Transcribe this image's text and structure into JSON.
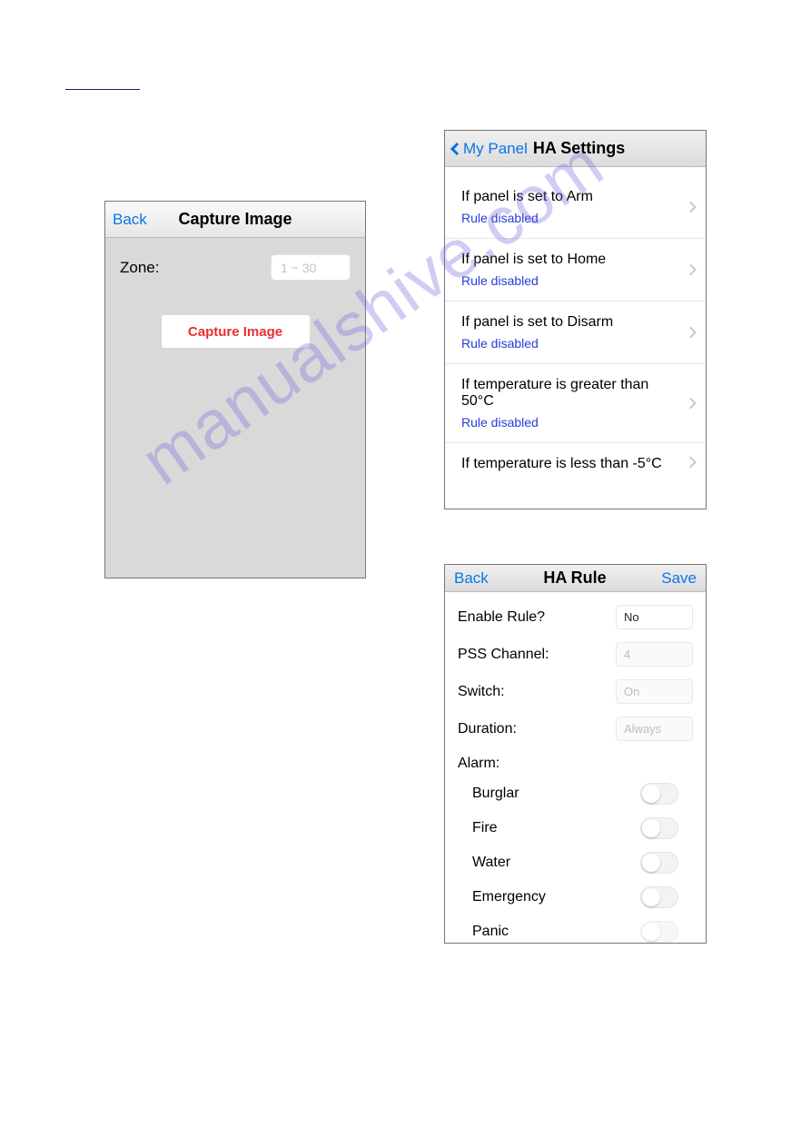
{
  "watermark": "manualshive.com",
  "capture": {
    "back": "Back",
    "title": "Capture Image",
    "zone_label": "Zone:",
    "zone_placeholder": "1 ~ 30",
    "button": "Capture Image"
  },
  "hasettings": {
    "back": "My Panel",
    "title": "HA Settings",
    "rules": [
      {
        "condition": "If panel is set to Arm",
        "status": "Rule disabled"
      },
      {
        "condition": "If panel is set to Home",
        "status": "Rule disabled"
      },
      {
        "condition": "If panel is set to Disarm",
        "status": "Rule disabled"
      },
      {
        "condition": "If temperature is greater than 50°C",
        "status": "Rule disabled"
      },
      {
        "condition": "If temperature is less than -5°C",
        "status": ""
      }
    ]
  },
  "harule": {
    "back": "Back",
    "title": "HA Rule",
    "save": "Save",
    "fields": {
      "enable_label": "Enable Rule?",
      "enable_value": "No",
      "pss_label": "PSS Channel:",
      "pss_value": "4",
      "switch_label": "Switch:",
      "switch_value": "On",
      "duration_label": "Duration:",
      "duration_value": "Always"
    },
    "alarm_label": "Alarm:",
    "alarms": [
      "Burglar",
      "Fire",
      "Water",
      "Emergency",
      "Panic"
    ]
  }
}
